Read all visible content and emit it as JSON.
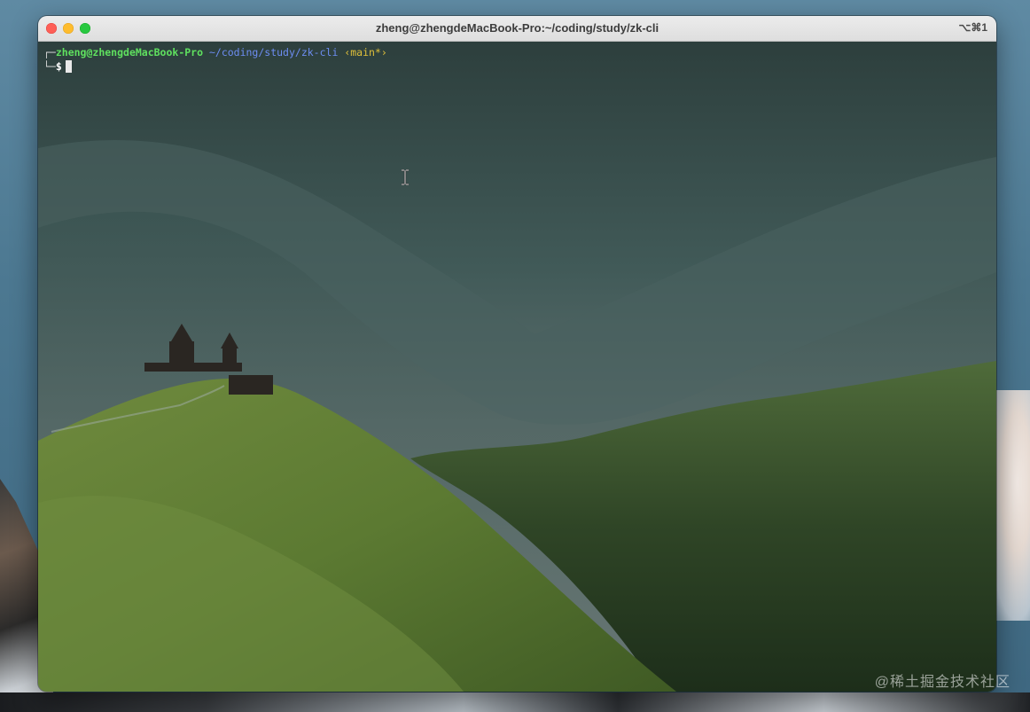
{
  "window": {
    "title": "zheng@zhengdeMacBook-Pro:~/coding/study/zk-cli",
    "shortcut": "⌥⌘1"
  },
  "terminal": {
    "prompt": {
      "corner_top": "┌─",
      "user_host": "zheng@zhengdeMacBook-Pro",
      "path": "~/coding/study/zk-cli",
      "branch": "‹main*›",
      "corner_bottom": "└─",
      "symbol": "$"
    }
  },
  "icons": {
    "close": "close-button",
    "minimize": "minimize-button",
    "maximize": "zoom-button",
    "text_cursor": "i-beam-cursor-icon"
  },
  "colors": {
    "user_host": "#5fe05f",
    "path": "#6d8df2",
    "branch": "#e0c03a"
  },
  "watermark": "@稀土掘金技术社区"
}
